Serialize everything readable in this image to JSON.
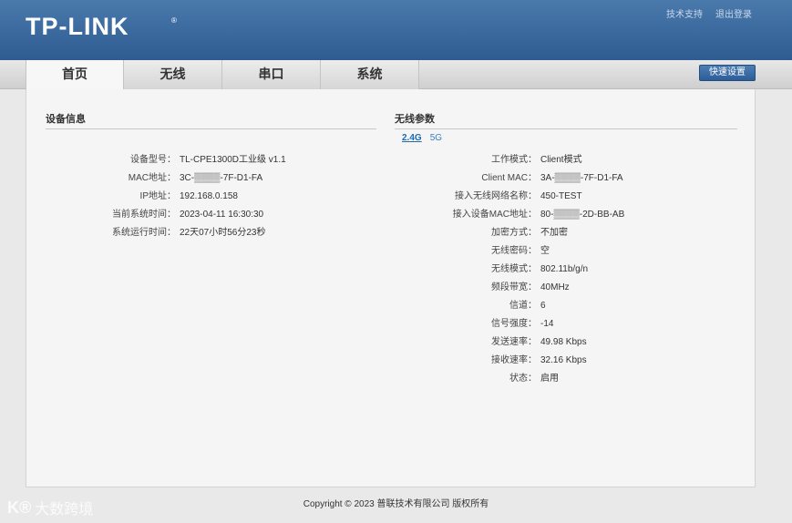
{
  "header": {
    "logo": "TP-LINK",
    "logo_mark": "®",
    "links": {
      "support": "技术支持",
      "logout": "退出登录"
    }
  },
  "tabs": [
    {
      "label": "首页",
      "active": true
    },
    {
      "label": "无线",
      "active": false
    },
    {
      "label": "串口",
      "active": false
    },
    {
      "label": "系统",
      "active": false
    }
  ],
  "quick_setup_label": "快速设置",
  "device_info": {
    "title": "设备信息",
    "rows": [
      {
        "label": "设备型号：",
        "value": "TL-CPE1300D工业级 v1.1"
      },
      {
        "label": "MAC地址：",
        "value": "3C-▒▒▒▒-7F-D1-FA"
      },
      {
        "label": "IP地址：",
        "value": "192.168.0.158"
      },
      {
        "label": "当前系统时间：",
        "value": "2023-04-11 16:30:30"
      },
      {
        "label": "系统运行时间：",
        "value": "22天07小时56分23秒"
      }
    ]
  },
  "wireless": {
    "title": "无线参数",
    "bands": [
      {
        "label": "2.4G",
        "active": true
      },
      {
        "label": "5G",
        "active": false
      }
    ],
    "rows": [
      {
        "label": "工作模式：",
        "value": "Client模式"
      },
      {
        "label": "Client MAC：",
        "value": "3A-▒▒▒▒-7F-D1-FA"
      },
      {
        "label": "接入无线网络名称：",
        "value": "450-TEST"
      },
      {
        "label": "接入设备MAC地址：",
        "value": "80-▒▒▒▒-2D-BB-AB"
      },
      {
        "label": "加密方式：",
        "value": "不加密"
      },
      {
        "label": "无线密码：",
        "value": "空"
      },
      {
        "label": "无线模式：",
        "value": "802.11b/g/n"
      },
      {
        "label": "频段带宽：",
        "value": "40MHz"
      },
      {
        "label": "信道：",
        "value": "6"
      },
      {
        "label": "信号强度：",
        "value": "-14"
      },
      {
        "label": "发送速率：",
        "value": "49.98 Kbps"
      },
      {
        "label": "接收速率：",
        "value": "32.16 Kbps"
      },
      {
        "label": "状态：",
        "value": "启用"
      }
    ]
  },
  "footer": "Copyright © 2023 普联技术有限公司 版权所有",
  "watermark": {
    "mark": "K®",
    "text": "大数跨境"
  },
  "colors": {
    "header_top": "#4a79ac",
    "header_bottom": "#2e5c92",
    "accent_link": "#1e6ab0",
    "panel_bg": "#f5f5f5"
  }
}
